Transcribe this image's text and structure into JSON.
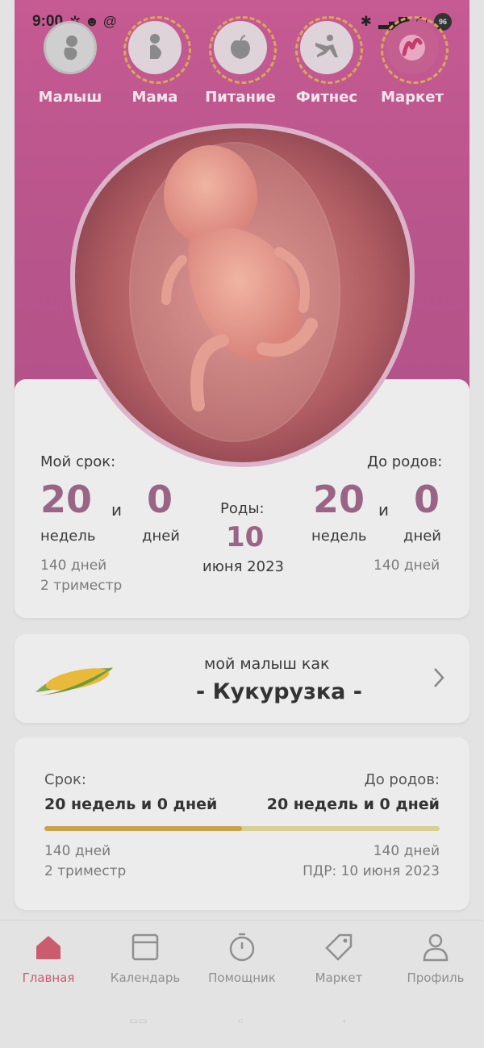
{
  "status_bar": {
    "time": "9:00",
    "battery": "96"
  },
  "top_nav": {
    "items": [
      {
        "label": "Малыш",
        "icon": "baby-icon"
      },
      {
        "label": "Мама",
        "icon": "pregnant-woman-icon"
      },
      {
        "label": "Питание",
        "icon": "apple-icon"
      },
      {
        "label": "Фитнес",
        "icon": "yoga-icon"
      },
      {
        "label": "Маркет",
        "icon": "market-logo-icon"
      }
    ]
  },
  "term": {
    "my_term_label": "Мой срок:",
    "weeks": "20",
    "and": "и",
    "days": "0",
    "weeks_unit": "недель",
    "days_unit": "дней",
    "total_days": "140 дней",
    "trimester": "2 триместр",
    "birth_label": "Роды:",
    "birth_day": "10",
    "birth_month_year": "июня 2023",
    "until_label": "До родов:",
    "until_weeks": "20",
    "until_and": "и",
    "until_days": "0",
    "until_weeks_unit": "недель",
    "until_days_unit": "дней",
    "until_total_days": "140 дней"
  },
  "fruit": {
    "prefix": "мой малыш как",
    "name": "- Кукурузка -",
    "icon": "corn-icon"
  },
  "progress": {
    "term_label": "Срок:",
    "term_value": "20 недель и 0 дней",
    "until_label": "До родов:",
    "until_value": "20 недель и 0 дней",
    "fraction": 0.5,
    "left_days": "140 дней",
    "left_trimester": "2 триместр",
    "right_days": "140 дней",
    "due_date": "ПДР: 10 июня 2023",
    "fill_color": "#c9a24a",
    "track_color": "#d8cf92"
  },
  "bottom_nav": {
    "items": [
      {
        "label": "Главная",
        "icon": "home-icon",
        "active": true
      },
      {
        "label": "Календарь",
        "icon": "calendar-icon",
        "active": false
      },
      {
        "label": "Помощник",
        "icon": "timer-icon",
        "active": false
      },
      {
        "label": "Маркет",
        "icon": "tag-icon",
        "active": false
      },
      {
        "label": "Профиль",
        "icon": "profile-icon",
        "active": false
      }
    ]
  },
  "colors": {
    "accent": "#c65a93",
    "number": "#9a6487",
    "active_tab": "#c95c6d"
  }
}
